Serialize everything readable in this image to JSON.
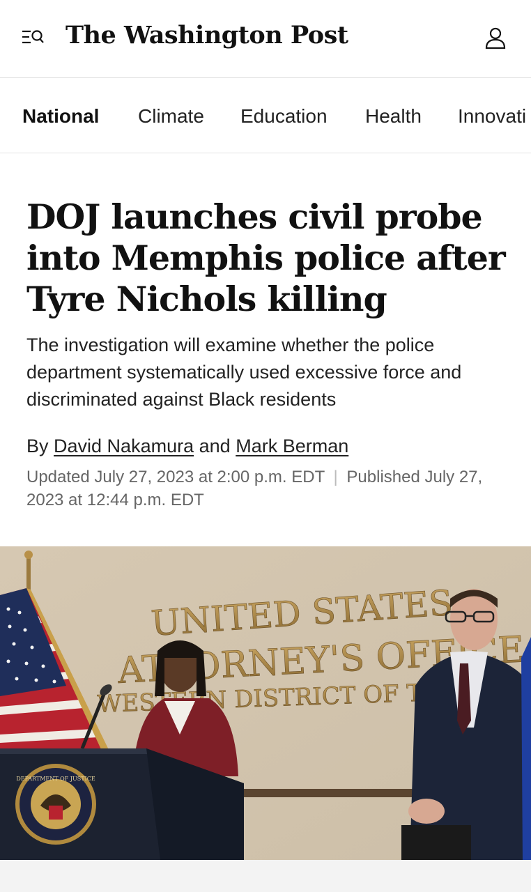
{
  "header": {
    "masthead": "The Washington Post",
    "menu_icon": "menu-search-icon",
    "account_icon": "user-icon"
  },
  "nav": {
    "tabs": [
      {
        "label": "National",
        "active": true
      },
      {
        "label": "Climate",
        "active": false
      },
      {
        "label": "Education",
        "active": false
      },
      {
        "label": "Health",
        "active": false
      },
      {
        "label": "Innovati",
        "active": false
      }
    ]
  },
  "article": {
    "headline": "DOJ launches civil probe into Memphis police after Tyre Nichols killing",
    "dek": "The investigation will examine whether the police department systematically used excessive force and discriminated against Black residents",
    "byline": {
      "prefix": "By",
      "author1": "David Nakamura",
      "conjunction": "and",
      "author2": "Mark Berman"
    },
    "updated": "Updated July 27, 2023 at 2:00 p.m. EDT",
    "separator": "|",
    "published": "Published July 27, 2023 at 12:44 p.m. EDT"
  },
  "photo": {
    "wall_text": {
      "line1": "UNITED STATES",
      "line2": "ATTORNEY'S OFFICE",
      "line3": "WESTERN DISTRICT OF TENNESSEE"
    },
    "seal_text": "DEPARTMENT OF JUSTICE"
  },
  "colors": {
    "accent": "#111111",
    "muted": "#666666",
    "divider": "#e3e3e3"
  }
}
